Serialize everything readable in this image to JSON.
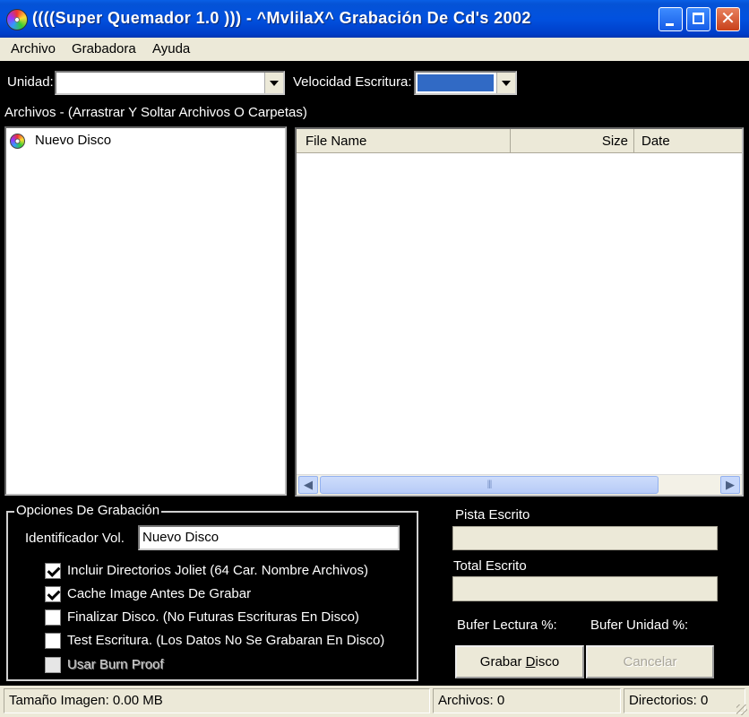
{
  "window": {
    "title": "((((Super Quemador 1.0 ))) - ^MvlilaX^ Grabación De Cd's 2002",
    "icon": "cd-icon",
    "controls": [
      "minimize-icon",
      "maximize-icon",
      "close-icon"
    ],
    "close_glyph": "✕"
  },
  "menu": {
    "items": [
      {
        "label": "Archivo"
      },
      {
        "label": "Grabadora"
      },
      {
        "label": "Ayuda"
      }
    ]
  },
  "drive": {
    "label": "Unidad:",
    "value": ""
  },
  "speed": {
    "label": "Velocidad Escritura:",
    "value": ""
  },
  "files": {
    "label": "Archivos - (Arrastrar Y Soltar Archivos O Carpetas)",
    "tree": [
      {
        "label": "Nuevo Disco",
        "icon": "cd-icon"
      }
    ],
    "columns": [
      {
        "label": "File Name"
      },
      {
        "label": "Size"
      },
      {
        "label": "Date"
      }
    ],
    "rows": []
  },
  "options": {
    "legend": "Opciones De Grabación",
    "volume_label": "Identificador Vol.",
    "volume_value": "Nuevo Disco",
    "checkboxes": [
      {
        "label": "Incluir Directorios Joliet (64 Car. Nombre Archivos)",
        "checked": true,
        "enabled": true
      },
      {
        "label": "Cache Image Antes De Grabar",
        "checked": true,
        "enabled": true
      },
      {
        "label": "Finalizar Disco. (No Futuras Escrituras En Disco)",
        "checked": false,
        "enabled": true
      },
      {
        "label": "Test Escritura. (Los Datos No Se Grabaran En Disco)",
        "checked": false,
        "enabled": true
      },
      {
        "label": "Usar Burn Proof",
        "checked": false,
        "enabled": false
      }
    ]
  },
  "progress": {
    "track_label": "Pista Escrito",
    "track_value": 0,
    "total_label": "Total Escrito",
    "total_value": 0,
    "read_buffer_label": "Bufer Lectura %:",
    "drive_buffer_label": "Bufer Unidad %:"
  },
  "buttons": {
    "burn": "Grabar Disco",
    "cancel": "Cancelar"
  },
  "status": {
    "image_size": "Tamaño Imagen: 0.00 MB",
    "files": "Archivos: 0",
    "directories": "Directorios: 0"
  },
  "colors": {
    "titlebar": "#0151df",
    "window_bg": "#000000",
    "face": "#ece9d8",
    "selection": "#316ac5"
  }
}
